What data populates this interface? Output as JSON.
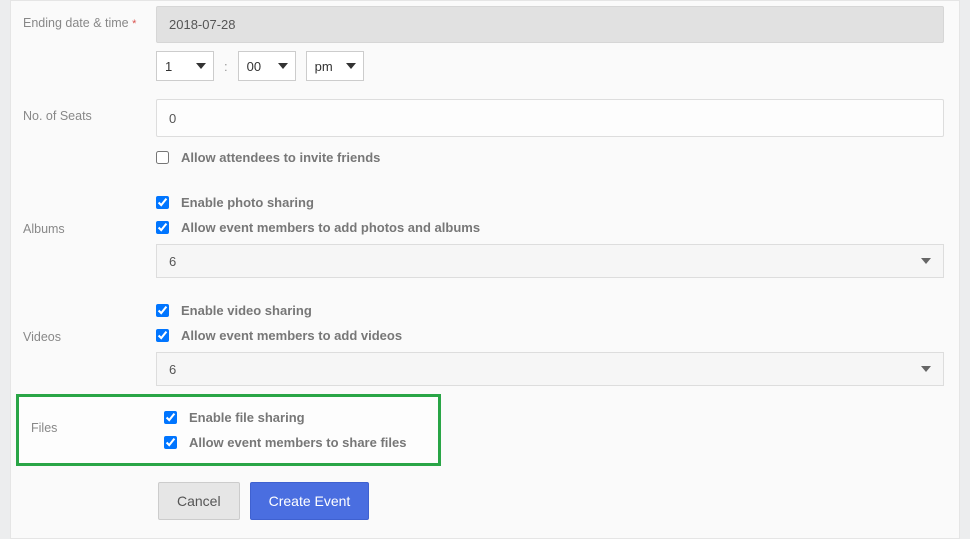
{
  "ending": {
    "label": "Ending date & time",
    "date": "2018-07-28",
    "hour": "1",
    "minute": "00",
    "ampm": "pm"
  },
  "seats": {
    "label": "No. of Seats",
    "value": "0",
    "invite_label": "Allow attendees to invite friends",
    "invite_checked": false
  },
  "albums": {
    "label": "Albums",
    "enable_label": "Enable photo sharing",
    "allow_label": "Allow event members to add photos and albums",
    "select_value": "6"
  },
  "videos": {
    "label": "Videos",
    "enable_label": "Enable video sharing",
    "allow_label": "Allow event members to add videos",
    "select_value": "6"
  },
  "files": {
    "label": "Files",
    "enable_label": "Enable file sharing",
    "allow_label": "Allow event members to share files"
  },
  "buttons": {
    "cancel": "Cancel",
    "create": "Create Event"
  }
}
